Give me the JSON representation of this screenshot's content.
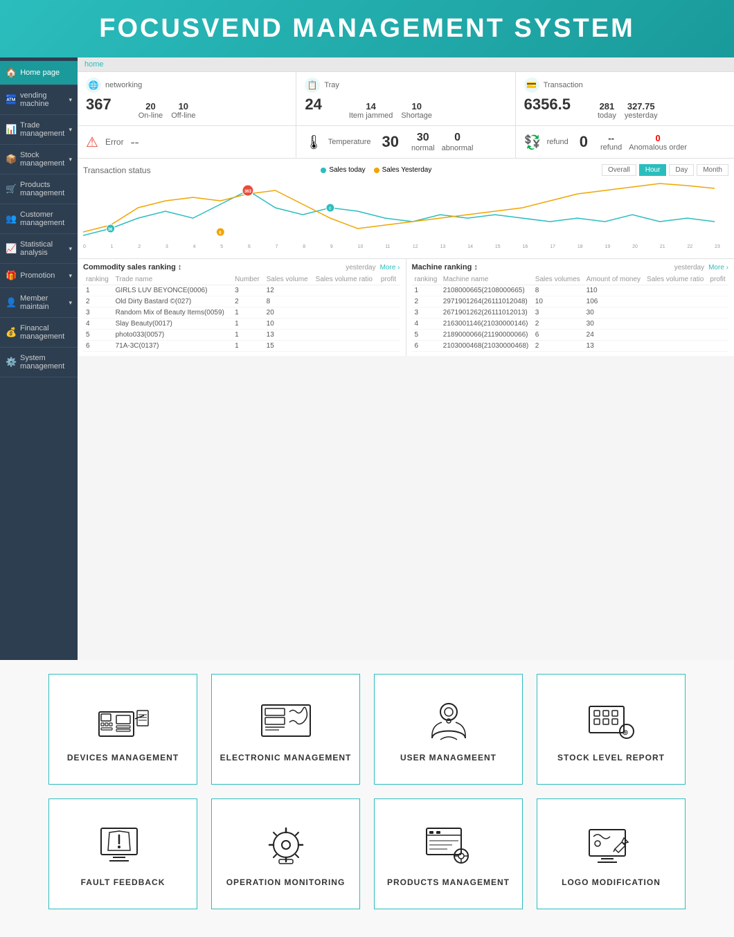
{
  "header": {
    "title": "FOCUSVEND MANAGEMENT SYSTEM"
  },
  "sidebar": {
    "items": [
      {
        "id": "home",
        "label": "Home page",
        "icon": "🏠",
        "active": true,
        "hasArrow": false
      },
      {
        "id": "vending",
        "label": "vending machine",
        "icon": "🏧",
        "hasArrow": true
      },
      {
        "id": "trade",
        "label": "Trade management",
        "icon": "📊",
        "hasArrow": true
      },
      {
        "id": "stock",
        "label": "Stock management",
        "icon": "📦",
        "hasArrow": true
      },
      {
        "id": "products",
        "label": "Products management",
        "icon": "🛒",
        "hasArrow": false
      },
      {
        "id": "customer",
        "label": "Customer management",
        "icon": "👥",
        "hasArrow": false
      },
      {
        "id": "statistical",
        "label": "Statistical analysis",
        "icon": "📈",
        "hasArrow": true
      },
      {
        "id": "promotion",
        "label": "Promotion",
        "icon": "🎁",
        "hasArrow": true
      },
      {
        "id": "member",
        "label": "Member maintain",
        "icon": "👤",
        "hasArrow": true
      },
      {
        "id": "financial",
        "label": "Financal management",
        "icon": "💰",
        "hasArrow": false
      },
      {
        "id": "system",
        "label": "System management",
        "icon": "⚙️",
        "hasArrow": false
      }
    ]
  },
  "breadcrumb": "home",
  "stats": {
    "networking": {
      "icon": "🌐",
      "label": "networking",
      "main": "367",
      "subs": [
        {
          "label": "On-line",
          "value": "20"
        },
        {
          "label": "Off-line",
          "value": "10"
        }
      ]
    },
    "tray": {
      "icon": "📋",
      "label": "Tray",
      "main": "24",
      "subs": [
        {
          "label": "Item jammed",
          "value": "14"
        },
        {
          "label": "Shortage",
          "value": "10"
        }
      ]
    },
    "transaction": {
      "icon": "💳",
      "label": "Transaction",
      "main": "6356.5",
      "subs": [
        {
          "label": "today",
          "value": "281"
        },
        {
          "label": "yesterday",
          "value": "327.75"
        }
      ]
    }
  },
  "errorRow": {
    "error": {
      "label": "Error",
      "value": "--"
    },
    "temperature": {
      "label": "Temperature",
      "main": "30",
      "subs": [
        {
          "label": "normal",
          "value": "30"
        },
        {
          "label": "abnormal",
          "value": "0"
        }
      ]
    },
    "refund": {
      "label": "refund",
      "main": "0",
      "subs": [
        {
          "label": "refund",
          "value": "--"
        },
        {
          "label": "Anomalous order",
          "value": "0"
        }
      ]
    }
  },
  "chart": {
    "title": "Transaction status",
    "legend": [
      {
        "label": "Sales today",
        "color": "#2bbdbd"
      },
      {
        "label": "Sales Yesterday",
        "color": "#f0a500"
      }
    ],
    "tabs": [
      "Overall",
      "Hour",
      "Day",
      "Month"
    ],
    "activeTab": "Hour"
  },
  "tables": {
    "commodity": {
      "title": "Commodity sales ranking",
      "yesterday": "yesterday",
      "more": "More",
      "columns": [
        "ranking",
        "Trade name",
        "Number",
        "Sales volume",
        "Sales volume ratio",
        "profit"
      ],
      "rows": [
        [
          "1",
          "GIRLS LUV BEYONCE(0006)",
          "3",
          "12",
          "",
          ""
        ],
        [
          "2",
          "Old Dirty Bastard ©(027)",
          "2",
          "8",
          "",
          ""
        ],
        [
          "3",
          "Random Mix of Beauty Items(0059)",
          "1",
          "20",
          "",
          ""
        ],
        [
          "4",
          "Slay Beauty(0017)",
          "1",
          "10",
          "",
          ""
        ],
        [
          "5",
          "photo033(0057)",
          "1",
          "13",
          "",
          ""
        ],
        [
          "6",
          "71A-3C(0137)",
          "1",
          "15",
          "",
          ""
        ]
      ]
    },
    "machine": {
      "title": "Machine ranking",
      "yesterday": "yesterday",
      "more": "More",
      "columns": [
        "ranking",
        "Machine name",
        "Sales volumes",
        "Amount of money",
        "Sales volume ratio",
        "profit"
      ],
      "rows": [
        [
          "1",
          "2108000665(2108000665)",
          "8",
          "110",
          "",
          ""
        ],
        [
          "2",
          "2971901264(26111012048)",
          "10",
          "106",
          "",
          ""
        ],
        [
          "3",
          "2671901262(26111012013)",
          "3",
          "30",
          "",
          ""
        ],
        [
          "4",
          "2163001146(21030000146)",
          "2",
          "30",
          "",
          ""
        ],
        [
          "5",
          "2189000066(21190000066)",
          "6",
          "24",
          "",
          ""
        ],
        [
          "6",
          "2103000468(21030000468)",
          "2",
          "13",
          "",
          ""
        ]
      ]
    }
  },
  "bottomGrid": {
    "row1": [
      {
        "id": "devices",
        "label": "DEVICES MANAGEMENT"
      },
      {
        "id": "electronic",
        "label": "ELECTRONIC MANAGEMENT"
      },
      {
        "id": "user",
        "label": "USER MANAGMEENT"
      },
      {
        "id": "stock-level",
        "label": "STOCK LEVEL REPORT"
      }
    ],
    "row2": [
      {
        "id": "fault",
        "label": "FAULT FEEDBACK"
      },
      {
        "id": "operation",
        "label": "OPERATION MONITORING"
      },
      {
        "id": "products",
        "label": "PRODUCTS MANAGEMENT"
      },
      {
        "id": "logo",
        "label": "LOGO MODIFICATION"
      }
    ]
  },
  "colors": {
    "teal": "#2bbdbd",
    "orange": "#f0a500",
    "dark": "#2d3e50"
  }
}
